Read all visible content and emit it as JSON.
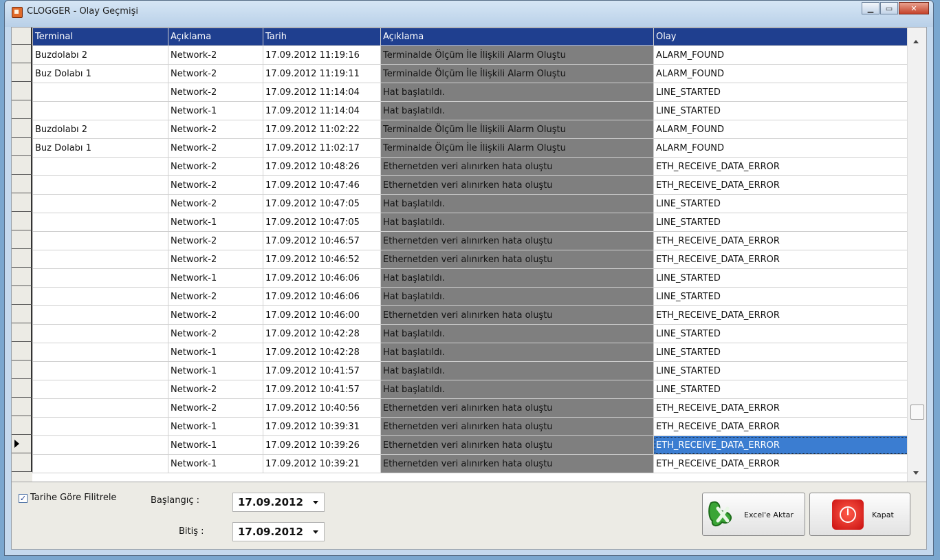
{
  "window": {
    "title": "CLOGGER - Olay Geçmişi"
  },
  "grid": {
    "columns": [
      "Terminal",
      "Açıklama",
      "Tarih",
      "Açıklama",
      "Olay"
    ],
    "rows": [
      [
        "Buzdolabı 2",
        "Network-2",
        "17.09.2012 11:19:16",
        "Terminalde Ölçüm İle İlişkili Alarm Oluştu",
        "ALARM_FOUND"
      ],
      [
        "Buz Dolabı 1",
        "Network-2",
        "17.09.2012 11:19:11",
        "Terminalde Ölçüm İle İlişkili Alarm Oluştu",
        "ALARM_FOUND"
      ],
      [
        "",
        "Network-2",
        "17.09.2012 11:14:04",
        "Hat başlatıldı.",
        "LINE_STARTED"
      ],
      [
        "",
        "Network-1",
        "17.09.2012 11:14:04",
        "Hat başlatıldı.",
        "LINE_STARTED"
      ],
      [
        "Buzdolabı 2",
        "Network-2",
        "17.09.2012 11:02:22",
        "Terminalde Ölçüm İle İlişkili Alarm Oluştu",
        "ALARM_FOUND"
      ],
      [
        "Buz Dolabı 1",
        "Network-2",
        "17.09.2012 11:02:17",
        "Terminalde Ölçüm İle İlişkili Alarm Oluştu",
        "ALARM_FOUND"
      ],
      [
        "",
        "Network-2",
        "17.09.2012 10:48:26",
        "Ethernetden veri alınırken hata oluştu",
        "ETH_RECEIVE_DATA_ERROR"
      ],
      [
        "",
        "Network-2",
        "17.09.2012 10:47:46",
        "Ethernetden veri alınırken hata oluştu",
        "ETH_RECEIVE_DATA_ERROR"
      ],
      [
        "",
        "Network-2",
        "17.09.2012 10:47:05",
        "Hat başlatıldı.",
        "LINE_STARTED"
      ],
      [
        "",
        "Network-1",
        "17.09.2012 10:47:05",
        "Hat başlatıldı.",
        "LINE_STARTED"
      ],
      [
        "",
        "Network-2",
        "17.09.2012 10:46:57",
        "Ethernetden veri alınırken hata oluştu",
        "ETH_RECEIVE_DATA_ERROR"
      ],
      [
        "",
        "Network-2",
        "17.09.2012 10:46:52",
        "Ethernetden veri alınırken hata oluştu",
        "ETH_RECEIVE_DATA_ERROR"
      ],
      [
        "",
        "Network-1",
        "17.09.2012 10:46:06",
        "Hat başlatıldı.",
        "LINE_STARTED"
      ],
      [
        "",
        "Network-2",
        "17.09.2012 10:46:06",
        "Hat başlatıldı.",
        "LINE_STARTED"
      ],
      [
        "",
        "Network-2",
        "17.09.2012 10:46:00",
        "Ethernetden veri alınırken hata oluştu",
        "ETH_RECEIVE_DATA_ERROR"
      ],
      [
        "",
        "Network-2",
        "17.09.2012 10:42:28",
        "Hat başlatıldı.",
        "LINE_STARTED"
      ],
      [
        "",
        "Network-1",
        "17.09.2012 10:42:28",
        "Hat başlatıldı.",
        "LINE_STARTED"
      ],
      [
        "",
        "Network-1",
        "17.09.2012 10:41:57",
        "Hat başlatıldı.",
        "LINE_STARTED"
      ],
      [
        "",
        "Network-2",
        "17.09.2012 10:41:57",
        "Hat başlatıldı.",
        "LINE_STARTED"
      ],
      [
        "",
        "Network-2",
        "17.09.2012 10:40:56",
        "Ethernetden veri alınırken hata oluştu",
        "ETH_RECEIVE_DATA_ERROR"
      ],
      [
        "",
        "Network-1",
        "17.09.2012 10:39:31",
        "Ethernetden veri alınırken hata oluştu",
        "ETH_RECEIVE_DATA_ERROR"
      ],
      [
        "",
        "Network-1",
        "17.09.2012 10:39:26",
        "Ethernetden veri alınırken hata oluştu",
        "ETH_RECEIVE_DATA_ERROR"
      ],
      [
        "",
        "Network-1",
        "17.09.2012 10:39:21",
        "Ethernetden veri alınırken hata oluştu",
        "ETH_RECEIVE_DATA_ERROR"
      ]
    ],
    "selected_row": 21,
    "colors": {
      "header_bg": "#1f3f8f",
      "desc_bg": "#7f7f7f",
      "selected_bg": "#3b7dd1"
    }
  },
  "filter": {
    "checkbox_label": "Tarihe Göre Filitrele",
    "checked": true,
    "start_label": "Başlangıç :",
    "start_value": "17.09.2012",
    "end_label": "Bitiş :",
    "end_value": "17.09.2012"
  },
  "buttons": {
    "excel_label": "Excel'e Aktar",
    "close_label": "Kapat"
  },
  "icons": [
    "app-icon",
    "minimize-icon",
    "maximize-icon",
    "close-icon",
    "excel-icon",
    "power-icon"
  ]
}
